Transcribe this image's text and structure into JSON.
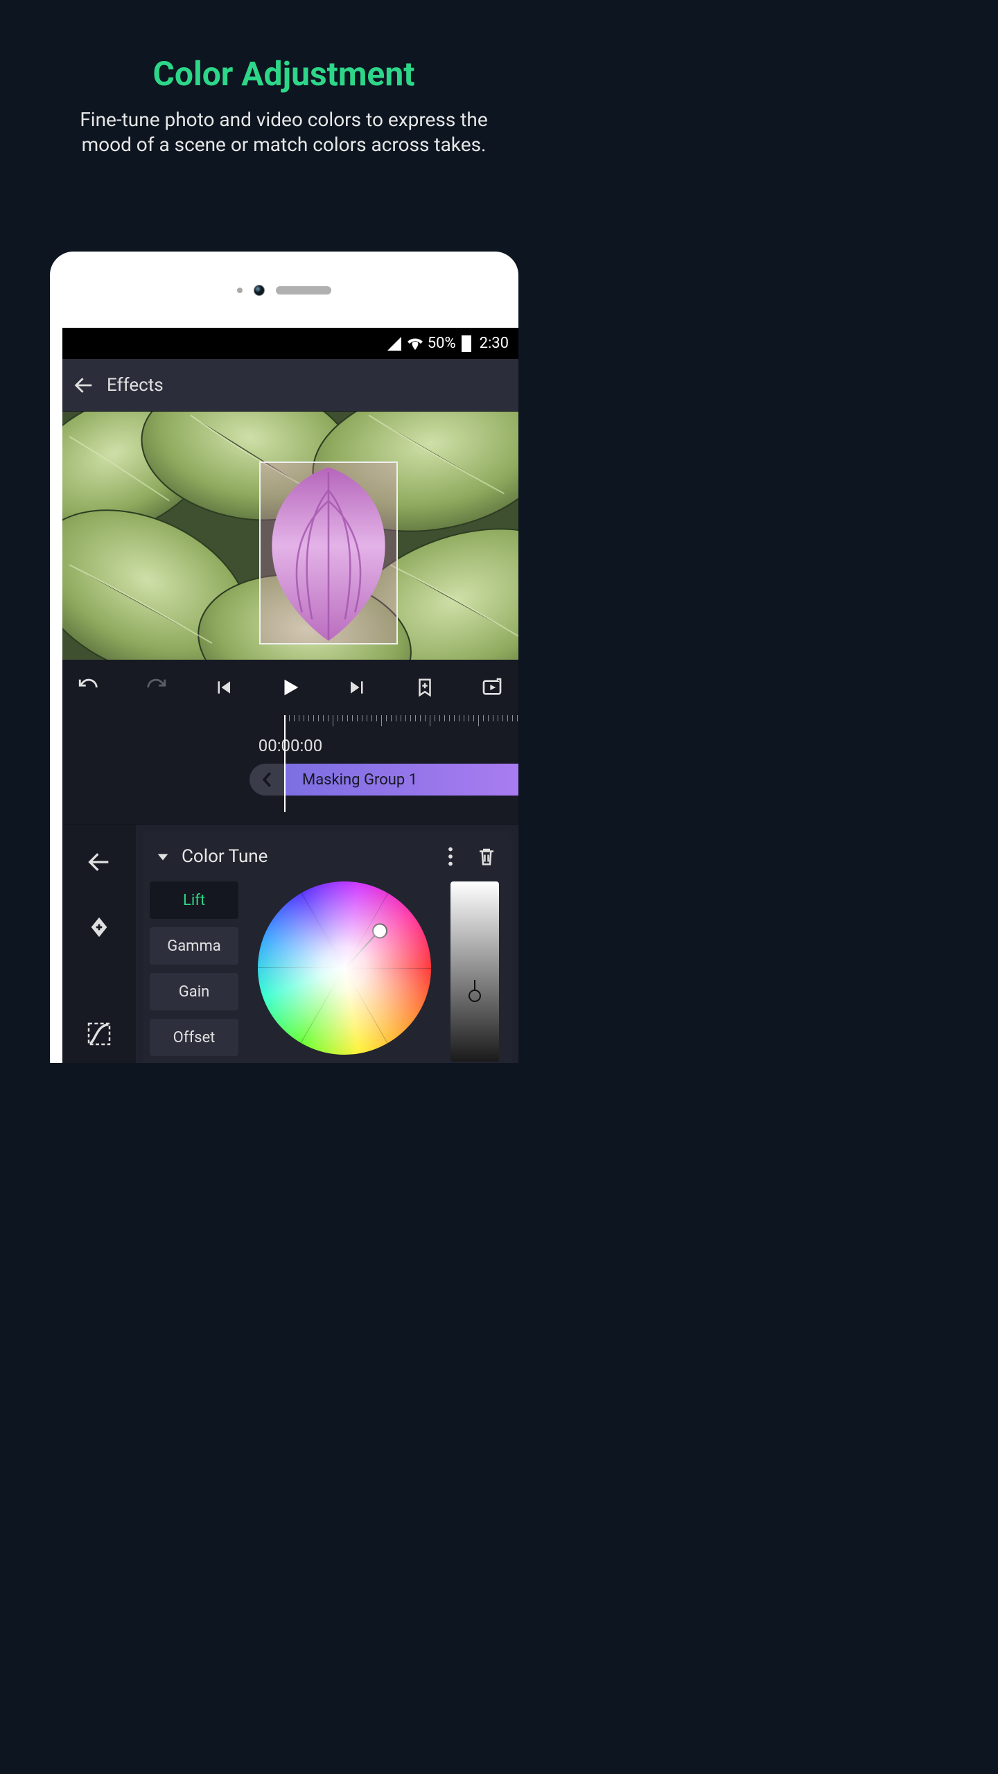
{
  "promo": {
    "title": "Color Adjustment",
    "subtitle": "Fine-tune photo and video colors to express the mood of a scene or match colors across takes."
  },
  "status": {
    "battery": "50%",
    "time": "2:30"
  },
  "appbar": {
    "title": "Effects"
  },
  "timeline": {
    "timecode": "00:00:00",
    "clip_label": "Masking Group 1"
  },
  "effects": {
    "panel_title": "Color Tune",
    "tabs": {
      "lift": "Lift",
      "gamma": "Gamma",
      "gain": "Gain",
      "offset": "Offset"
    },
    "active_tab": "lift"
  }
}
